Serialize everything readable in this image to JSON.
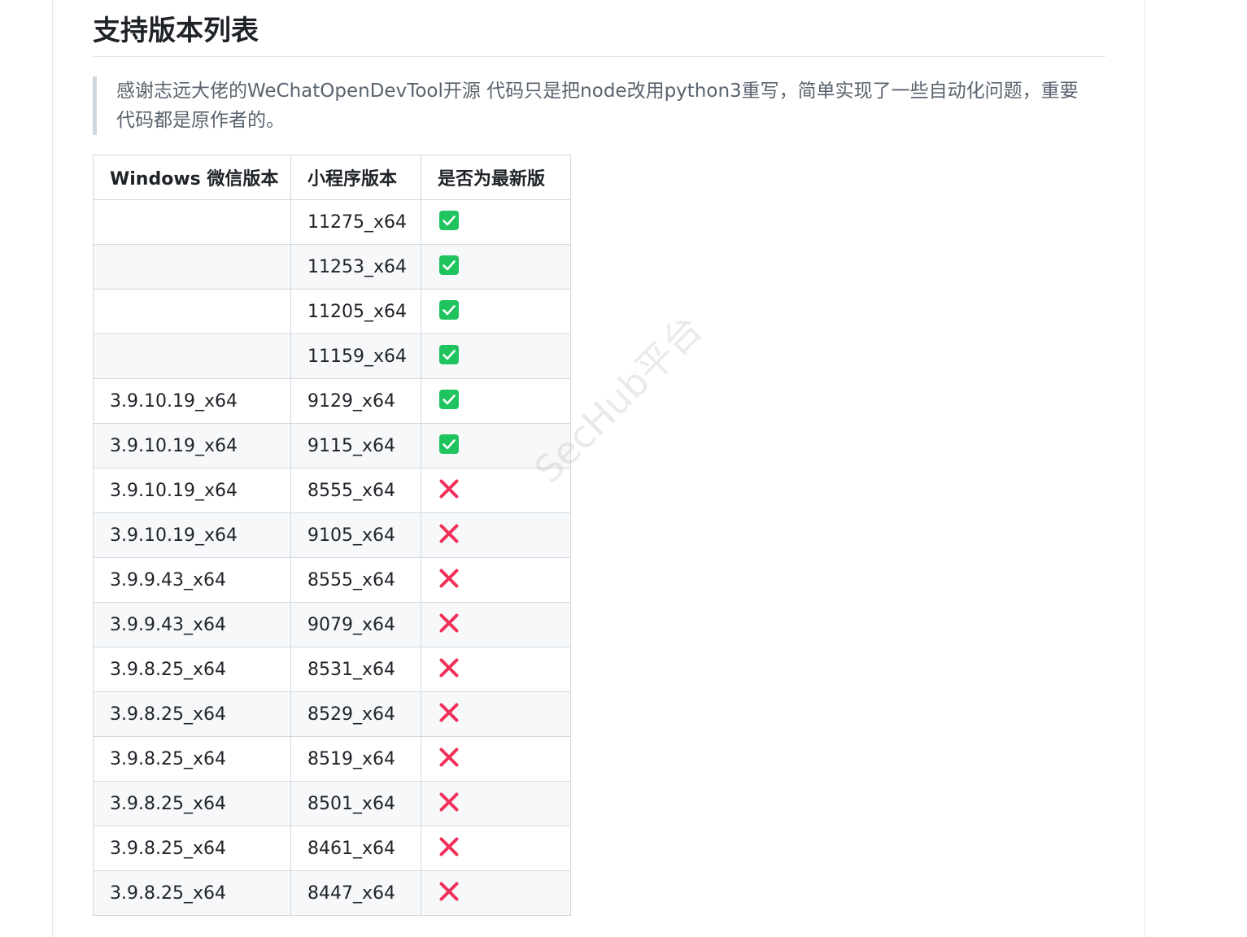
{
  "heading": "支持版本列表",
  "quote": {
    "line1": "感谢志远大佬的WeChatOpenDevTool开源 代码只是把node改用python3重写，简单实现了一些自动化问题，重要",
    "line2": "代码都是原作者的。"
  },
  "table": {
    "headers": [
      "Windows 微信版本",
      "小程序版本",
      "是否为最新版"
    ],
    "rows": [
      {
        "windows": "",
        "miniprogram": "11275_x64",
        "supported": true
      },
      {
        "windows": "",
        "miniprogram": "11253_x64",
        "supported": true
      },
      {
        "windows": "",
        "miniprogram": "11205_x64",
        "supported": true
      },
      {
        "windows": "",
        "miniprogram": "11159_x64",
        "supported": true
      },
      {
        "windows": "3.9.10.19_x64",
        "miniprogram": "9129_x64",
        "supported": true
      },
      {
        "windows": "3.9.10.19_x64",
        "miniprogram": "9115_x64",
        "supported": true
      },
      {
        "windows": "3.9.10.19_x64",
        "miniprogram": "8555_x64",
        "supported": false
      },
      {
        "windows": "3.9.10.19_x64",
        "miniprogram": "9105_x64",
        "supported": false
      },
      {
        "windows": "3.9.9.43_x64",
        "miniprogram": "8555_x64",
        "supported": false
      },
      {
        "windows": "3.9.9.43_x64",
        "miniprogram": "9079_x64",
        "supported": false
      },
      {
        "windows": "3.9.8.25_x64",
        "miniprogram": "8531_x64",
        "supported": false
      },
      {
        "windows": "3.9.8.25_x64",
        "miniprogram": "8529_x64",
        "supported": false
      },
      {
        "windows": "3.9.8.25_x64",
        "miniprogram": "8519_x64",
        "supported": false
      },
      {
        "windows": "3.9.8.25_x64",
        "miniprogram": "8501_x64",
        "supported": false
      },
      {
        "windows": "3.9.8.25_x64",
        "miniprogram": "8461_x64",
        "supported": false
      },
      {
        "windows": "3.9.8.25_x64",
        "miniprogram": "8447_x64",
        "supported": false
      }
    ]
  },
  "icons": {
    "supported": "check-mark-button-icon",
    "unsupported": "cross-mark-icon"
  },
  "colors": {
    "check_green": "#1fc45f",
    "cross_red": "#f0305a"
  },
  "watermark": "SecHub平台"
}
